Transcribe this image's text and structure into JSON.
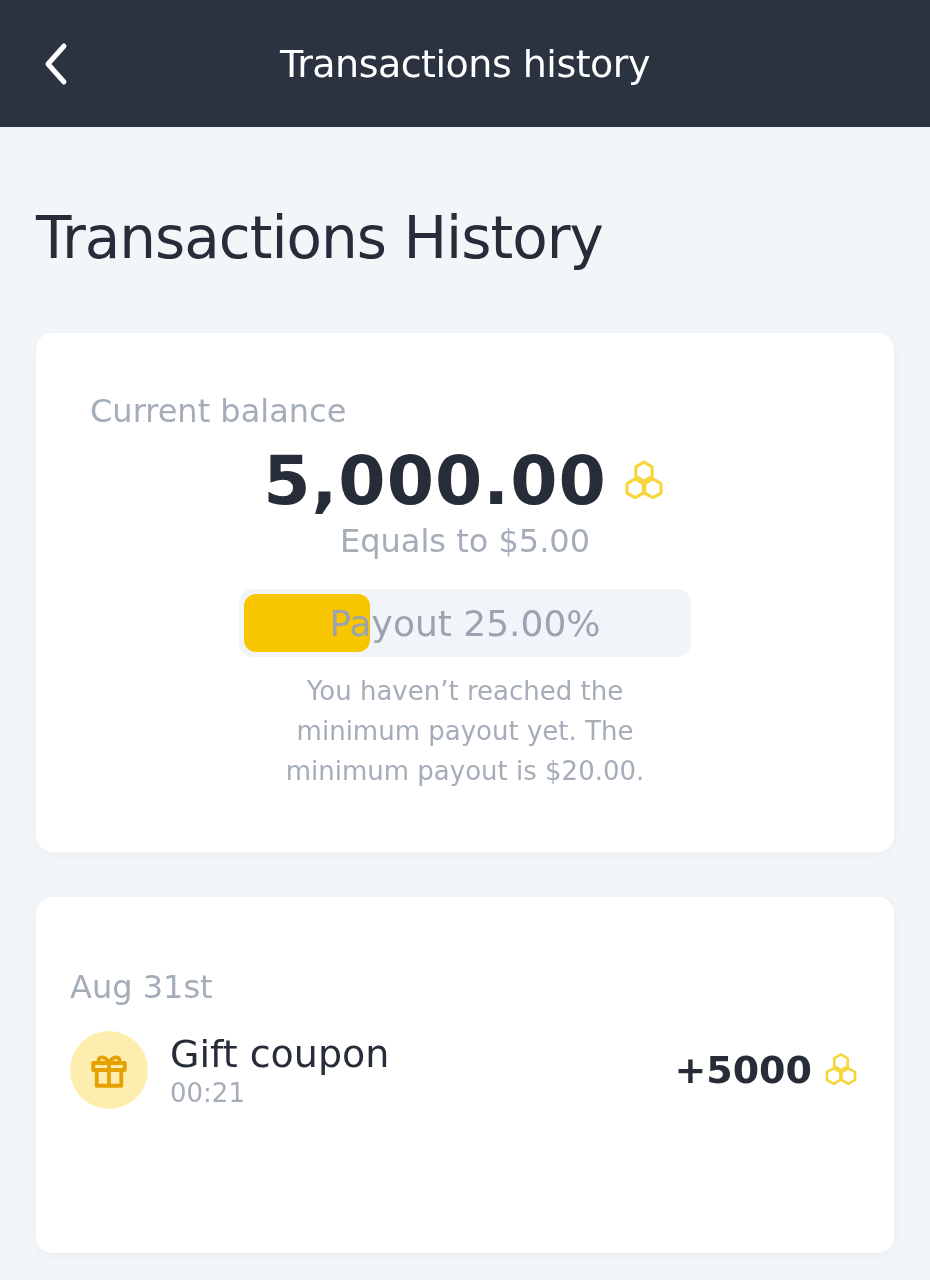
{
  "header": {
    "title": "Transactions history"
  },
  "page_title": "Transactions History",
  "balance_card": {
    "label": "Current balance",
    "amount": "5,000.00",
    "equivalent": "Equals to $5.00",
    "payout": {
      "label": "Payout 25.00%",
      "level": 0.29
    },
    "note": "You haven’t reached the minimum payout yet. The minimum payout is $20.00."
  },
  "transactions": [
    {
      "date": "Aug 31st",
      "items": [
        {
          "kind": "gift",
          "title": "Gift coupon",
          "time": "00:21",
          "amount": "+5000"
        }
      ]
    }
  ]
}
